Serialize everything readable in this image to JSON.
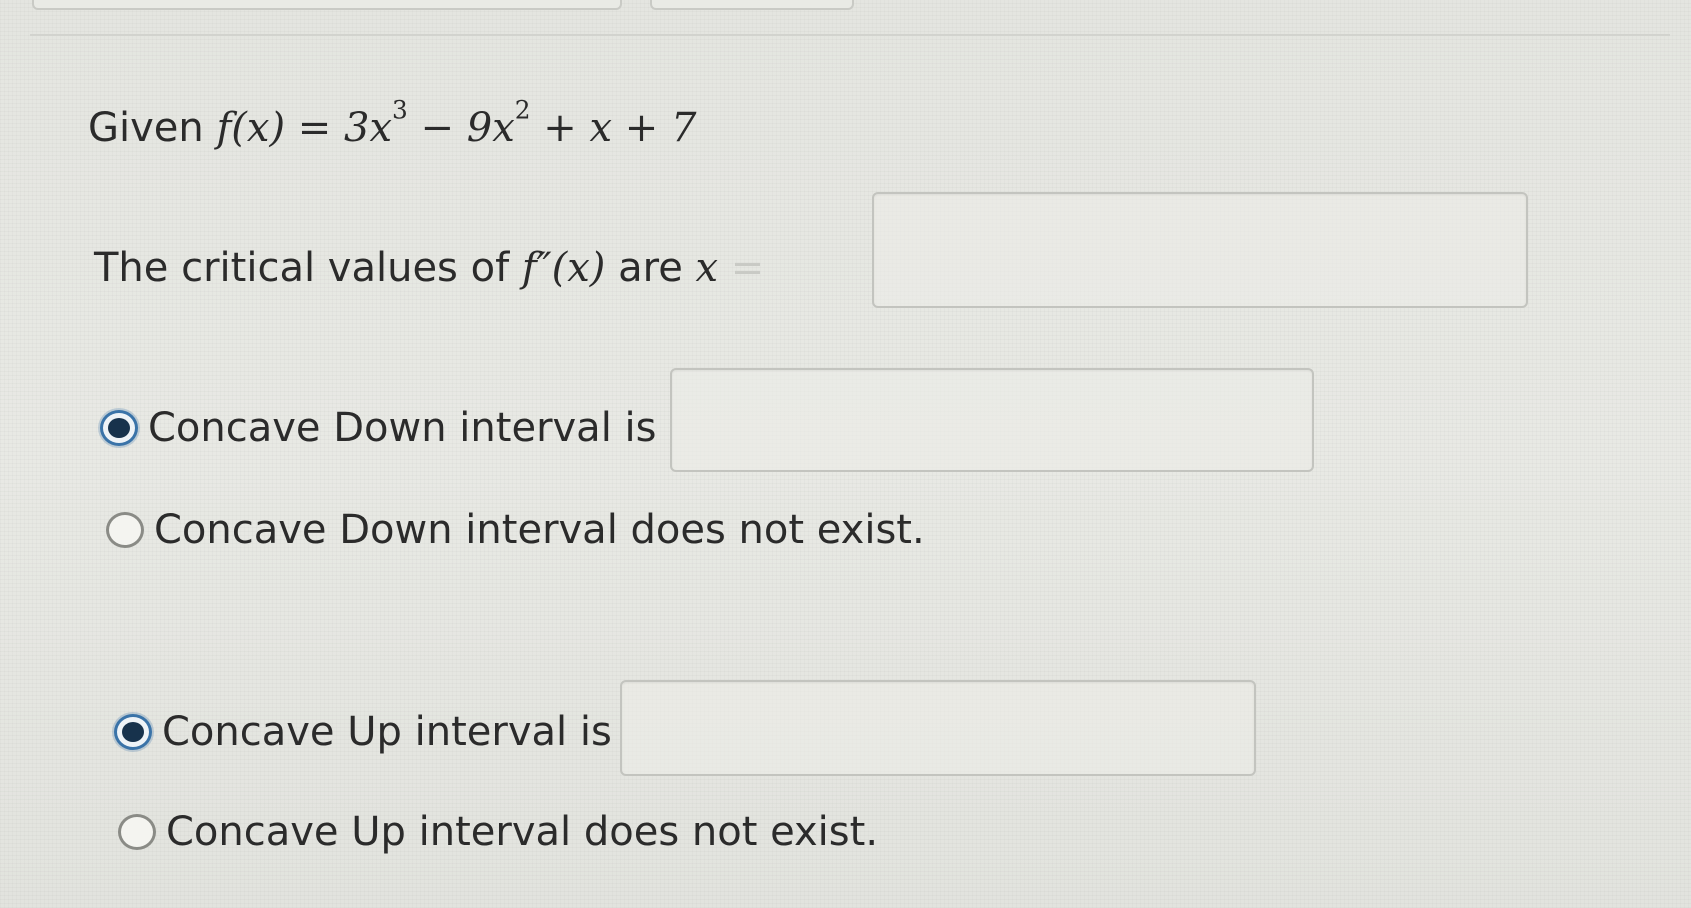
{
  "header": {
    "given_label": "Given",
    "function_lhs": "f(x) = ",
    "function_rhs": {
      "t1": "3x",
      "e1": "3",
      "t2": " − 9x",
      "e2": "2",
      "t3": " + x + 7"
    }
  },
  "critical": {
    "prefix": "The critical values of",
    "expr": "f″(x)",
    "suffix": "are",
    "var": "x",
    "equals": "=",
    "value": ""
  },
  "concave_down": {
    "option_interval_label": "Concave Down interval is",
    "option_interval_selected": true,
    "interval_value": "",
    "option_none_label": "Concave Down interval does not exist.",
    "option_none_selected": false
  },
  "concave_up": {
    "option_interval_label": "Concave Up interval is",
    "option_interval_selected": true,
    "interval_value": "",
    "option_none_label": "Concave Up interval does not exist.",
    "option_none_selected": false
  },
  "colors": {
    "radio_selected": "#3a73a8",
    "radio_dot": "#17324c",
    "text": "#2b2b2b"
  }
}
